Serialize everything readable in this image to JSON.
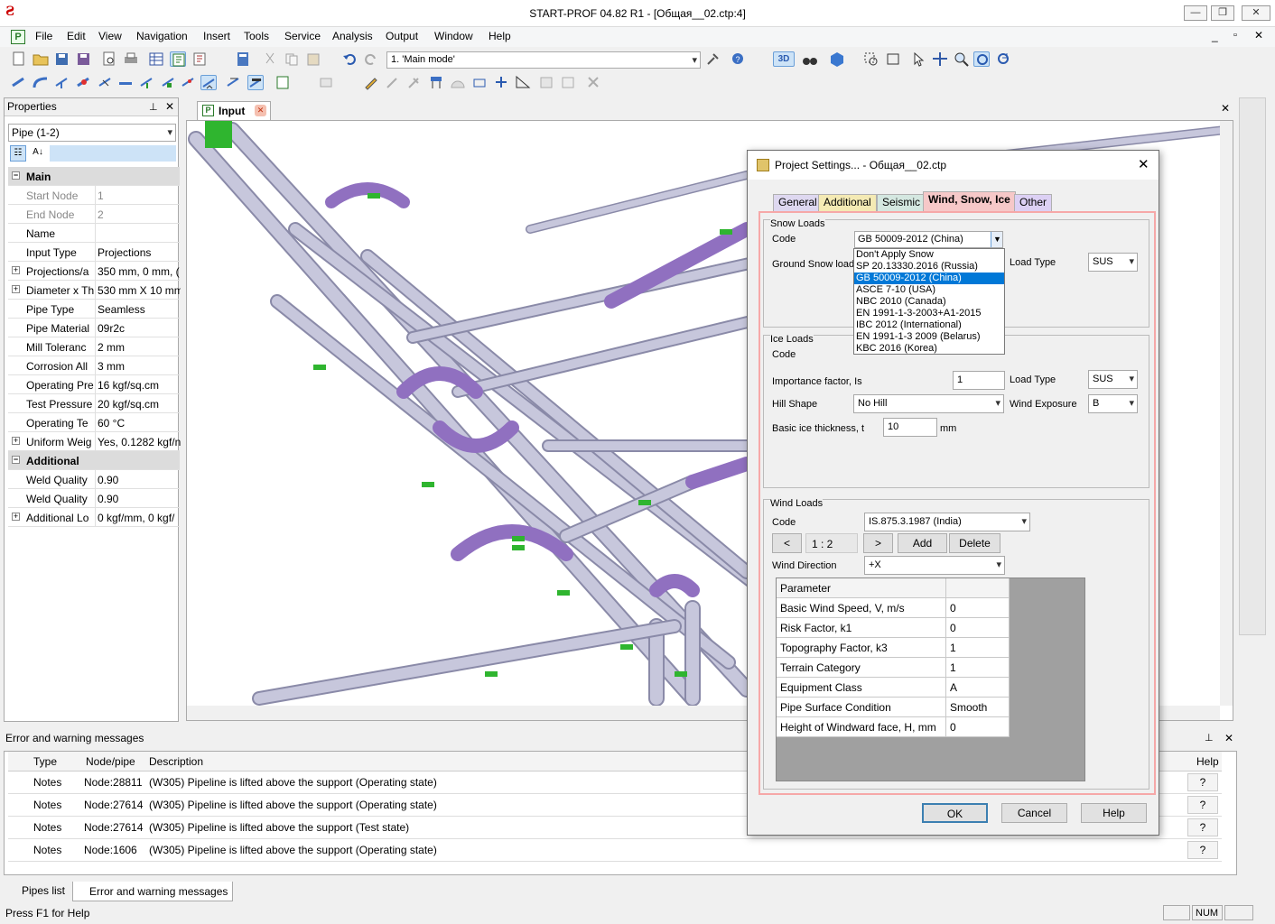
{
  "window": {
    "title": "START-PROF 04.82 R1 - [Общая__02.ctp:4]"
  },
  "menu": [
    "File",
    "Edit",
    "View",
    "Navigation",
    "Insert",
    "Tools",
    "Service",
    "Analysis",
    "Output",
    "Window",
    "Help"
  ],
  "toolbar": {
    "mode_select": "1. 'Main mode'",
    "view_3d": "3D"
  },
  "properties": {
    "title": "Properties",
    "selector": "Pipe (1-2)",
    "rows": [
      {
        "type": "cat",
        "key": "Main",
        "expander": "−"
      },
      {
        "key": "Start Node",
        "value": "1",
        "dim": true
      },
      {
        "key": "End Node",
        "value": "2",
        "dim": true
      },
      {
        "key": "Name",
        "value": ""
      },
      {
        "key": "Input Type",
        "value": "Projections"
      },
      {
        "key": "Projections/a",
        "value": "350 mm, 0 mm, (",
        "expander": "+"
      },
      {
        "key": "Diameter x Th",
        "value": "530 mm X 10 mm",
        "expander": "+"
      },
      {
        "key": "Pipe Type",
        "value": "Seamless"
      },
      {
        "key": "Pipe Material",
        "value": "09r2c"
      },
      {
        "key": "Mill Toleranc",
        "value": "2 mm"
      },
      {
        "key": "Corrosion All",
        "value": "3 mm"
      },
      {
        "key": "Operating Pre",
        "value": "16 kgf/sq.cm"
      },
      {
        "key": "Test Pressure",
        "value": "20 kgf/sq.cm"
      },
      {
        "key": "Operating Te",
        "value": "60 °C"
      },
      {
        "key": "Uniform Weig",
        "value": "Yes, 0.1282 kgf/n",
        "expander": "+"
      },
      {
        "type": "cat",
        "key": "Additional",
        "expander": "−"
      },
      {
        "key": "Weld Quality",
        "value": "0.90"
      },
      {
        "key": "Weld Quality",
        "value": "0.90"
      },
      {
        "key": "Additional Lo",
        "value": "0 kgf/mm, 0 kgf/",
        "expander": "+"
      }
    ]
  },
  "doc_tab": "Input",
  "errors": {
    "title": "Error and warning messages",
    "columns": [
      "Type",
      "Node/pipe",
      "Description",
      "Help"
    ],
    "rows": [
      {
        "type": "Notes",
        "node": "Node:28811",
        "desc": "(W305) Pipeline is lifted above the support (Operating state)",
        "help": "?"
      },
      {
        "type": "Notes",
        "node": "Node:27614",
        "desc": "(W305) Pipeline is lifted above the support (Operating state)",
        "help": "?"
      },
      {
        "type": "Notes",
        "node": "Node:27614",
        "desc": "(W305) Pipeline is lifted above the support (Test state)",
        "help": "?"
      },
      {
        "type": "Notes",
        "node": "Node:1606",
        "desc": "(W305) Pipeline is lifted above the support (Operating state)",
        "help": "?"
      }
    ]
  },
  "bottom_tabs": [
    "Pipes list",
    "Error and warning messages"
  ],
  "status": {
    "text": "Press F1 for Help",
    "num": "NUM"
  },
  "dialog": {
    "title": "Project Settings... - Общая__02.ctp",
    "tabs": [
      "General",
      "Additional",
      "Seismic",
      "Wind, Snow, Ice",
      "Other"
    ],
    "snow": {
      "group": "Snow Loads",
      "code_label": "Code",
      "code_value": "GB 50009-2012 (China)",
      "ground_label": "Ground Snow load",
      "load_type_label": "Load Type",
      "load_type": "SUS",
      "options": [
        "Don't Apply Snow",
        "SP 20.13330.2016 (Russia)",
        "GB 50009-2012 (China)",
        "ASCE 7-10 (USA)",
        "NBC 2010 (Canada)",
        "EN 1991-1-3-2003+A1-2015",
        "IBC 2012 (International)",
        "EN 1991-1-3 2009 (Belarus)",
        "KBC 2016 (Korea)"
      ]
    },
    "ice": {
      "group": "Ice Loads",
      "code_label": "Code",
      "code_partial": "ASCE 7-10 (USA)",
      "importance_label": "Importance factor, Is",
      "importance": "1",
      "load_type_label": "Load Type",
      "load_type": "SUS",
      "hill_label": "Hill Shape",
      "hill": "No Hill",
      "exposure_label": "Wind Exposure",
      "exposure": "B",
      "thickness_label": "Basic ice thickness, t",
      "thickness": "10",
      "unit": "mm"
    },
    "wind": {
      "group": "Wind Loads",
      "code_label": "Code",
      "code_value": "IS.875.3.1987 (India)",
      "prev": "<",
      "counter": "1 : 2",
      "next": ">",
      "add": "Add",
      "delete": "Delete",
      "direction_label": "Wind Direction",
      "direction": "+X",
      "param_header": "Parameter",
      "params": [
        {
          "name": "Basic Wind Speed, V, m/s",
          "value": "0"
        },
        {
          "name": "Risk Factor, k1",
          "value": "0"
        },
        {
          "name": "Topography Factor, k3",
          "value": "1"
        },
        {
          "name": "Terrain Category",
          "value": "1"
        },
        {
          "name": "Equipment Class",
          "value": "A"
        },
        {
          "name": "Pipe Surface Condition",
          "value": "Smooth"
        },
        {
          "name": "Height of Windward face, H, mm",
          "value": "0"
        }
      ]
    },
    "ok": "OK",
    "cancel": "Cancel",
    "help": "Help"
  }
}
